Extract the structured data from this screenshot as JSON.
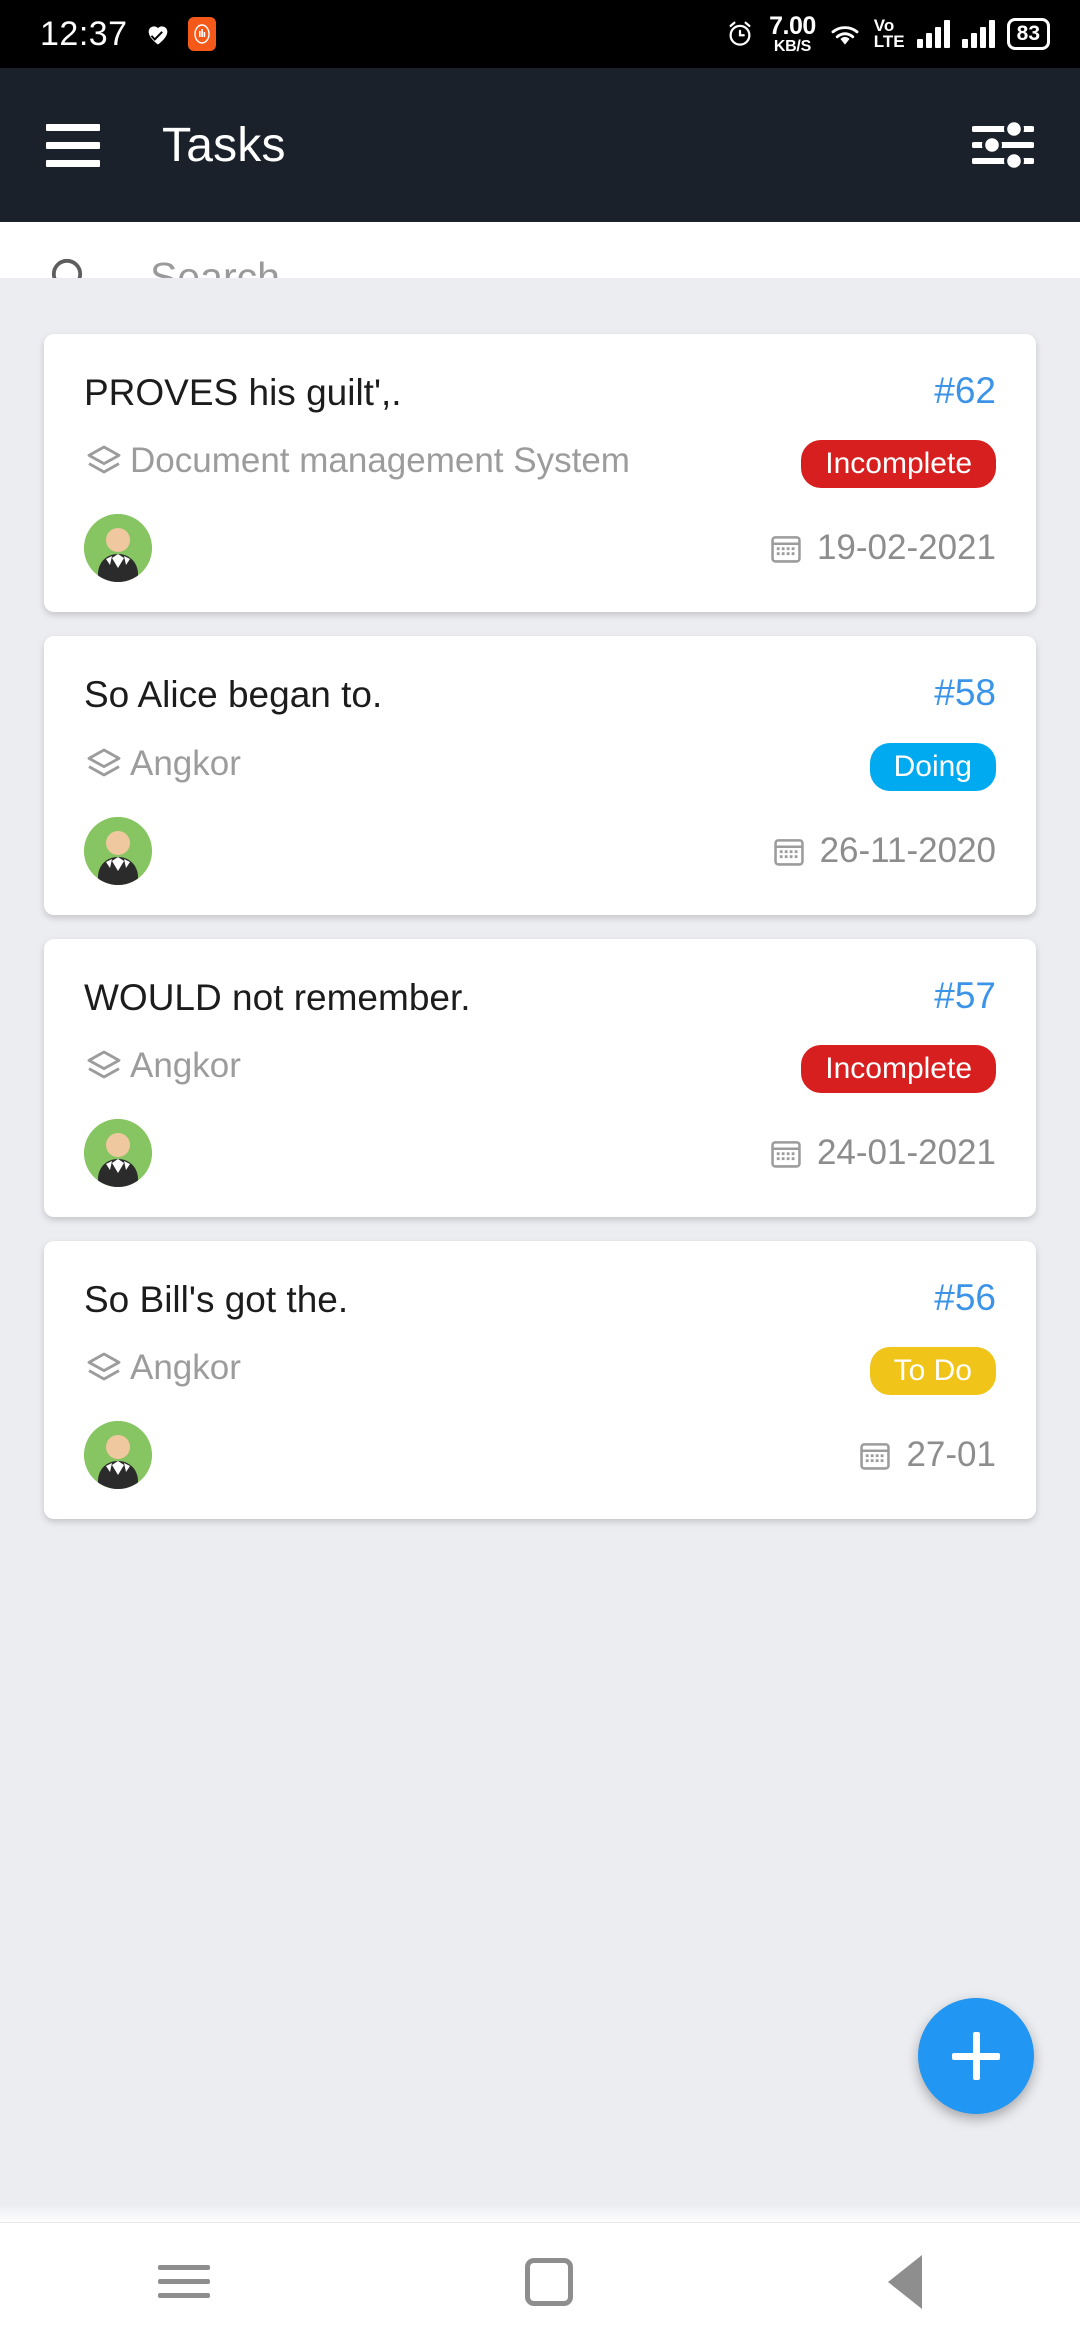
{
  "status_bar": {
    "time": "12:37",
    "heart_icon": "heart-icon",
    "mi_icon": "mi-band-icon",
    "alarm_icon": "alarm-icon",
    "net_speed_value": "7.00",
    "net_speed_unit": "KB/S",
    "wifi_icon": "wifi-icon",
    "volte_line1": "Vo",
    "volte_line2": "LTE",
    "signal_icon": "signal-bars-icon",
    "battery": "83"
  },
  "app_bar": {
    "menu_icon": "hamburger-menu-icon",
    "title": "Tasks",
    "filter_icon": "filter-sliders-icon"
  },
  "search": {
    "icon": "search-icon",
    "placeholder": "Search...",
    "value": ""
  },
  "colors": {
    "appbar_bg": "#1b212a",
    "page_bg": "#ecedf1",
    "accent_blue": "#2196f3",
    "id_blue": "#3b94e8",
    "incomplete": "#d81f1f",
    "doing": "#00aaf0",
    "todo": "#f0c418",
    "avatar_bg": "#86c561"
  },
  "tasks": [
    {
      "title": "PROVES his guilt',.",
      "id": "#62",
      "project": "Document management System",
      "status": "Incomplete",
      "status_color": "#d81f1f",
      "date": "19-02-2021",
      "avatar": "user-avatar"
    },
    {
      "title": "So Alice began to.",
      "id": "#58",
      "project": "Angkor",
      "status": "Doing",
      "status_color": "#00aaf0",
      "date": "26-11-2020",
      "avatar": "user-avatar"
    },
    {
      "title": "WOULD not remember.",
      "id": "#57",
      "project": "Angkor",
      "status": "Incomplete",
      "status_color": "#d81f1f",
      "date": "24-01-2021",
      "avatar": "user-avatar"
    },
    {
      "title": "So Bill's got the.",
      "id": "#56",
      "project": "Angkor",
      "status": "To Do",
      "status_color": "#f0c418",
      "date": "27-01",
      "avatar": "user-avatar"
    }
  ],
  "fab": {
    "label": "+",
    "name": "add-task-button"
  },
  "nav_bar": {
    "recent_icon": "recent-apps-icon",
    "home_icon": "home-icon",
    "back_icon": "back-icon"
  }
}
